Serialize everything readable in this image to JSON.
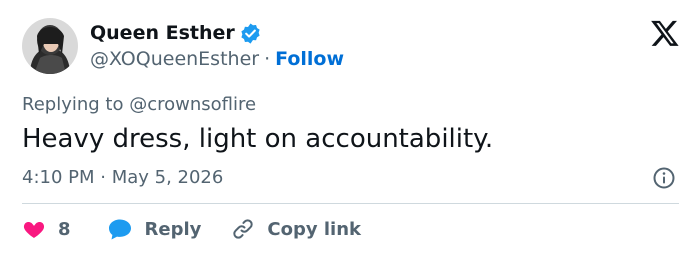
{
  "author": {
    "display_name": "Queen Esther",
    "handle": "@XOQueenEsther",
    "separator": "·",
    "follow_label": "Follow",
    "verified": true
  },
  "reply_context": {
    "prefix": "Replying to ",
    "mention": "@crownsoflire"
  },
  "tweet": {
    "text": "Heavy dress, light on accountability.",
    "timestamp": "4:10 PM · May 5, 2026"
  },
  "actions": {
    "like_count": "8",
    "reply_label": "Reply",
    "copy_label": "Copy link"
  },
  "icons": {
    "verified": "verified-badge-icon",
    "platform": "x-logo-icon",
    "info": "info-icon",
    "like": "heart-icon",
    "reply": "speech-bubble-icon",
    "copy": "link-icon"
  },
  "colors": {
    "text_primary": "#0f1419",
    "text_secondary": "#536471",
    "link_blue": "#006fd6",
    "verified_blue": "#1d9bf0",
    "heart_pink": "#f91880",
    "divider": "#cfd9de"
  }
}
